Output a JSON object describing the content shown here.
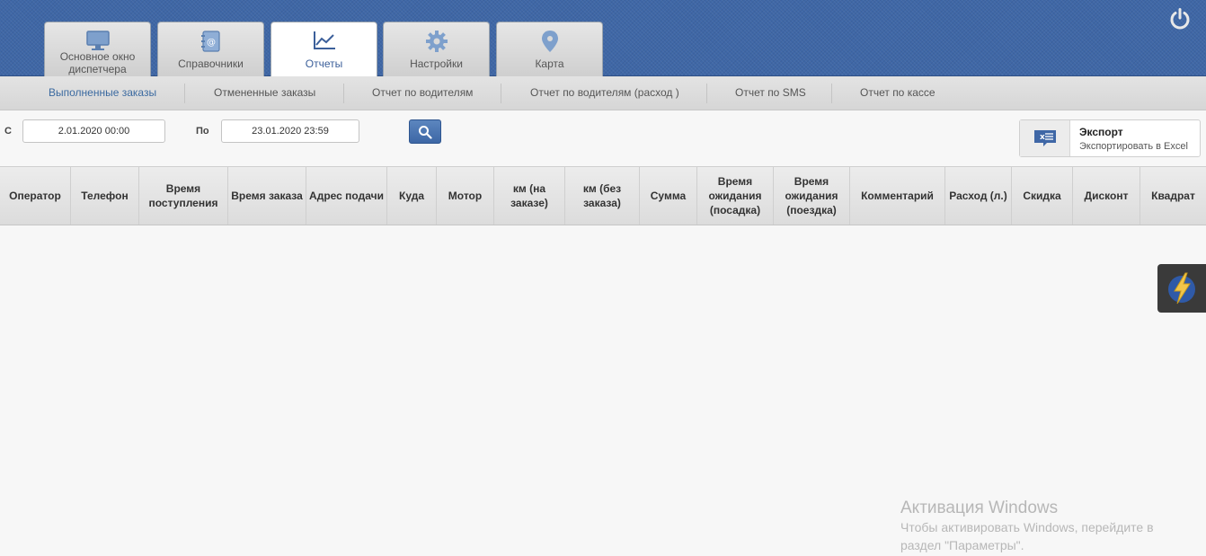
{
  "tabs": [
    {
      "label_line1": "Основное окно",
      "label_line2": "диспетчера",
      "icon": "monitor-icon",
      "active": false
    },
    {
      "label": "Справочники",
      "icon": "address-book-icon",
      "active": false
    },
    {
      "label": "Отчеты",
      "icon": "chart-icon",
      "active": true
    },
    {
      "label": "Настройки",
      "icon": "gear-icon",
      "active": false
    },
    {
      "label": "Карта",
      "icon": "map-pin-icon",
      "active": false
    }
  ],
  "subnav": [
    {
      "label": "Выполненные заказы",
      "active": true
    },
    {
      "label": "Отмененные заказы"
    },
    {
      "label": "Отчет по водителям"
    },
    {
      "label": "Отчет по водителям (расход )"
    },
    {
      "label": "Отчет по SMS"
    },
    {
      "label": "Отчет по кассе"
    }
  ],
  "filter": {
    "from_label": "С",
    "from_value": "2.01.2020 00:00",
    "to_label": "По",
    "to_value": "23.01.2020 23:59"
  },
  "export": {
    "title": "Экспорт",
    "subtitle": "Экспортировать в Excel"
  },
  "columns": [
    "Оператор",
    "Телефон",
    "Время поступления",
    "Время заказа",
    "Адрес подачи",
    "Куда",
    "Мотор",
    "км (на заказе)",
    "км (без заказа)",
    "Сумма",
    "Время ожидания (посадка)",
    "Время ожидания (поездка)",
    "Комментарий",
    "Расход (л.)",
    "Скидка",
    "Дисконт",
    "Квадрат"
  ],
  "watermark": {
    "title": "Активация Windows",
    "line1": "Чтобы активировать Windows, перейдите в",
    "line2": "раздел \"Параметры\"."
  },
  "colors": {
    "header_blue": "#3f67a6",
    "accent": "#3b6aa0"
  }
}
